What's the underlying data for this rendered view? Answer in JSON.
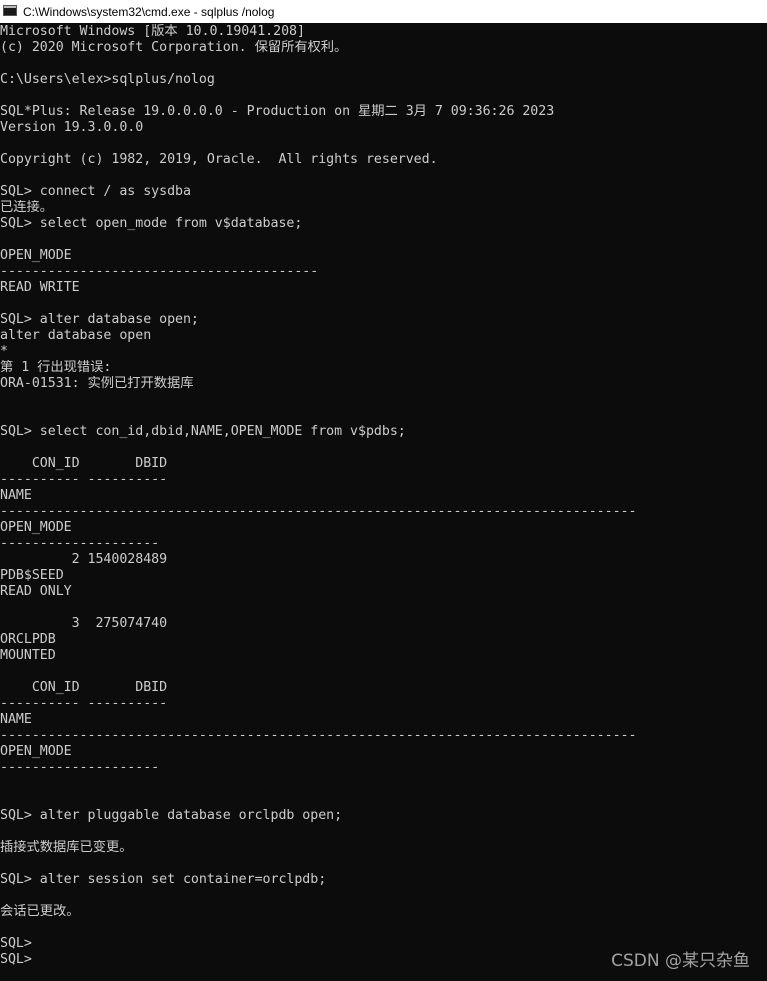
{
  "window": {
    "title": "C:\\Windows\\system32\\cmd.exe - sqlplus /nolog",
    "icon": "cmd-icon"
  },
  "console": {
    "lines": [
      "Microsoft Windows [版本 10.0.19041.208]",
      "(c) 2020 Microsoft Corporation. 保留所有权利。",
      "",
      "C:\\Users\\elex>sqlplus/nolog",
      "",
      "SQL*Plus: Release 19.0.0.0.0 - Production on 星期二 3月 7 09:36:26 2023",
      "Version 19.3.0.0.0",
      "",
      "Copyright (c) 1982, 2019, Oracle.  All rights reserved.",
      "",
      "SQL> connect / as sysdba",
      "已连接。",
      "SQL> select open_mode from v$database;",
      "",
      "OPEN_MODE",
      "----------------------------------------",
      "READ WRITE",
      "",
      "SQL> alter database open;",
      "alter database open",
      "*",
      "第 1 行出现错误:",
      "ORA-01531: 实例已打开数据库",
      "",
      "",
      "SQL> select con_id,dbid,NAME,OPEN_MODE from v$pdbs;",
      "",
      "    CON_ID       DBID",
      "---------- ----------",
      "NAME",
      "--------------------------------------------------------------------------------",
      "OPEN_MODE",
      "--------------------",
      "         2 1540028489",
      "PDB$SEED",
      "READ ONLY",
      "",
      "         3  275074740",
      "ORCLPDB",
      "MOUNTED",
      "",
      "    CON_ID       DBID",
      "---------- ----------",
      "NAME",
      "--------------------------------------------------------------------------------",
      "OPEN_MODE",
      "--------------------",
      "",
      "",
      "SQL> alter pluggable database orclpdb open;",
      "",
      "插接式数据库已变更。",
      "",
      "SQL> alter session set container=orclpdb;",
      "",
      "会话已更改。",
      "",
      "SQL>",
      "SQL>"
    ]
  },
  "watermark": {
    "text": "CSDN @某只杂鱼"
  }
}
